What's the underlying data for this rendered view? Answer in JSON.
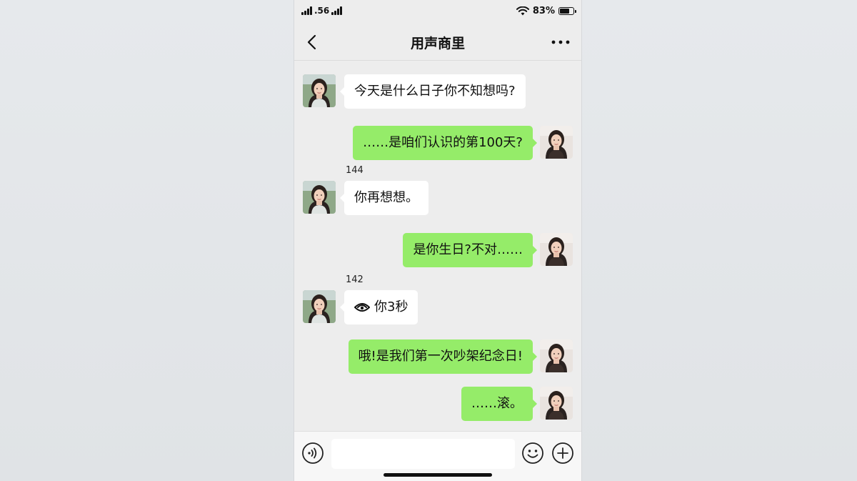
{
  "status_bar": {
    "carrier": ".56",
    "battery_text": "83%",
    "battery_level": 0.83
  },
  "nav": {
    "title": "用声商里",
    "back_icon": "chevron-left-icon",
    "more_icon": "more-dots-icon"
  },
  "messages": [
    {
      "side": "left",
      "text": "今天是什么日子你不知想吗?"
    },
    {
      "side": "right",
      "text": "……是咱们认识的第100天?"
    },
    {
      "side": "left",
      "label": "144",
      "text": "你再想想。"
    },
    {
      "side": "right",
      "text": "是你生日?不对……"
    },
    {
      "side": "left",
      "label": "142",
      "voice": true,
      "text": "你3秒"
    },
    {
      "side": "right",
      "text": "哦!是我们第一次吵架纪念日!"
    },
    {
      "side": "right",
      "text": "……滚。"
    }
  ],
  "input_bar": {
    "placeholder": "",
    "voice_icon": "voice-icon",
    "emoji_icon": "emoji-icon",
    "plus_icon": "plus-icon"
  },
  "colors": {
    "sent_bubble": "#95ec69",
    "received_bubble": "#ffffff",
    "background": "#ededed"
  }
}
